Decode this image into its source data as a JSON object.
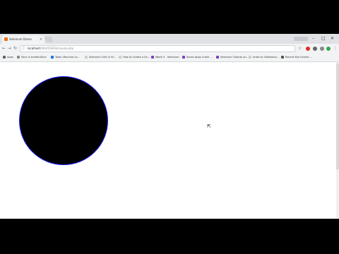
{
  "browser": {
    "tab": {
      "title": "Selenium Demo",
      "close_glyph": "×"
    },
    "window_controls": {
      "minimize": "–",
      "maximize": "□",
      "close": "✕"
    },
    "toolbar": {
      "back": "←",
      "forward": "→",
      "reload": "↻"
    },
    "address": {
      "host": "localhost",
      "path": "/html5/SVG/canvas.php"
    },
    "icons": {
      "star": "☆",
      "menu": "⋮"
    }
  },
  "bookmarks": [
    {
      "label": "Apps",
      "color": "#5f6368"
    },
    {
      "label": "Slice in Jmeter/Slice",
      "color": "#888888"
    },
    {
      "label": "Tools: Machine Le...",
      "color": "#1a73e8"
    },
    {
      "label": "Selenium Grid in Fir...",
      "color": "#cccccc"
    },
    {
      "label": "How to Create a Se...",
      "color": "#cccccc"
    },
    {
      "label": "Week 5 - Selenium",
      "color": "#7b3fbf"
    },
    {
      "label": "Saves Apps Crash ...",
      "color": "#7b3fbf"
    },
    {
      "label": "Selenium Tutorial on...",
      "color": "#7b3fbf"
    },
    {
      "label": "Index of /Software/...",
      "color": "#cccccc"
    },
    {
      "label": "Recent Key Events ...",
      "color": "#555555"
    }
  ],
  "page": {
    "cursor_glyph": "⇱"
  },
  "colors": {
    "circle_fill": "#000000",
    "circle_stroke": "#1a1aff"
  }
}
